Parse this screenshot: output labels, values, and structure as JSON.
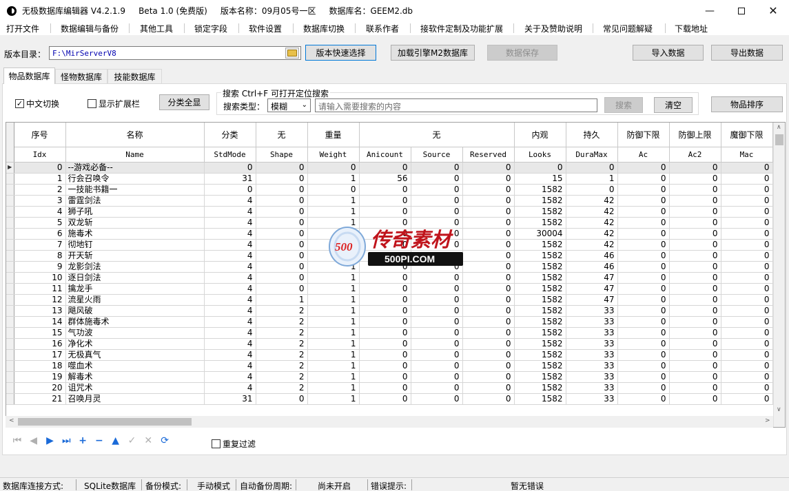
{
  "window": {
    "title": "无极数据库编辑器 V4.2.1.9     Beta 1.0 (免费版)     版本名称：09月05号一区     数据库名：GEEM2.db"
  },
  "menu": [
    "打开文件",
    "数据编辑与备份",
    "其他工具",
    "锁定字段",
    "软件设置",
    "数据库切换",
    "联系作者",
    "接软件定制及功能扩展",
    "关于及赞助说明",
    "常见问题解疑",
    "下载地址"
  ],
  "toolbar": {
    "version_dir_label": "版本目录：",
    "version_dir_value": "F:\\MirServerV8",
    "quick_select": "版本快速选择",
    "load_m2": "加载引擎M2数据库",
    "save": "数据保存",
    "import": "导入数据",
    "export": "导出数据"
  },
  "tabs": [
    "物品数据库",
    "怪物数据库",
    "技能数据库"
  ],
  "filters": {
    "chinese_switch": "中文切换",
    "chinese_checked": true,
    "show_ext": "显示扩展栏",
    "show_ext_checked": false,
    "category_all": "分类全显",
    "search_title": "搜索   Ctrl+F 可打开定位搜索",
    "search_type_label": "搜索类型：",
    "search_type_value": "模糊",
    "search_placeholder": "请输入需要搜索的内容",
    "search_btn": "搜索",
    "clear_btn": "清空",
    "sort_btn": "物品排序"
  },
  "grid": {
    "header_cn": [
      "序号",
      "名称",
      "分类",
      "无",
      "重量",
      "无",
      "内观",
      "持久",
      "防御下限",
      "防御上限",
      "魔御下限"
    ],
    "header_en": [
      "Idx",
      "Name",
      "StdMode",
      "Shape",
      "Weight",
      "Anicount",
      "Source",
      "Reserved",
      "Looks",
      "DuraMax",
      "Ac",
      "Ac2",
      "Mac"
    ],
    "rows": [
      [
        "0",
        "--游戏必备--",
        "0",
        "0",
        "0",
        "0",
        "0",
        "0",
        "0",
        "0",
        "0",
        "0",
        "0"
      ],
      [
        "1",
        "行会召唤令",
        "31",
        "0",
        "1",
        "56",
        "0",
        "0",
        "15",
        "1",
        "0",
        "0",
        "0"
      ],
      [
        "2",
        "一技能书籍一",
        "0",
        "0",
        "0",
        "0",
        "0",
        "0",
        "1582",
        "0",
        "0",
        "0",
        "0"
      ],
      [
        "3",
        "雷霆剑法",
        "4",
        "0",
        "1",
        "0",
        "0",
        "0",
        "1582",
        "42",
        "0",
        "0",
        "0"
      ],
      [
        "4",
        "狮子吼",
        "4",
        "0",
        "1",
        "0",
        "0",
        "0",
        "1582",
        "42",
        "0",
        "0",
        "0"
      ],
      [
        "5",
        "双龙斩",
        "4",
        "0",
        "1",
        "0",
        "0",
        "0",
        "1582",
        "42",
        "0",
        "0",
        "0"
      ],
      [
        "6",
        "施毒术",
        "4",
        "0",
        "1",
        "0",
        "0",
        "0",
        "30004",
        "42",
        "0",
        "0",
        "0"
      ],
      [
        "7",
        "彻地钉",
        "4",
        "0",
        "1",
        "0",
        "0",
        "0",
        "1582",
        "42",
        "0",
        "0",
        "0"
      ],
      [
        "8",
        "开天斩",
        "4",
        "0",
        "1",
        "0",
        "0",
        "0",
        "1582",
        "46",
        "0",
        "0",
        "0"
      ],
      [
        "9",
        "龙影剑法",
        "4",
        "0",
        "1",
        "0",
        "0",
        "0",
        "1582",
        "46",
        "0",
        "0",
        "0"
      ],
      [
        "10",
        "逐日剑法",
        "4",
        "0",
        "1",
        "0",
        "0",
        "0",
        "1582",
        "47",
        "0",
        "0",
        "0"
      ],
      [
        "11",
        "擒龙手",
        "4",
        "0",
        "1",
        "0",
        "0",
        "0",
        "1582",
        "47",
        "0",
        "0",
        "0"
      ],
      [
        "12",
        "流星火雨",
        "4",
        "1",
        "1",
        "0",
        "0",
        "0",
        "1582",
        "47",
        "0",
        "0",
        "0"
      ],
      [
        "13",
        "飓风破",
        "4",
        "2",
        "1",
        "0",
        "0",
        "0",
        "1582",
        "33",
        "0",
        "0",
        "0"
      ],
      [
        "14",
        "群体施毒术",
        "4",
        "2",
        "1",
        "0",
        "0",
        "0",
        "1582",
        "33",
        "0",
        "0",
        "0"
      ],
      [
        "15",
        "气功波",
        "4",
        "2",
        "1",
        "0",
        "0",
        "0",
        "1582",
        "33",
        "0",
        "0",
        "0"
      ],
      [
        "16",
        "净化术",
        "4",
        "2",
        "1",
        "0",
        "0",
        "0",
        "1582",
        "33",
        "0",
        "0",
        "0"
      ],
      [
        "17",
        "无极真气",
        "4",
        "2",
        "1",
        "0",
        "0",
        "0",
        "1582",
        "33",
        "0",
        "0",
        "0"
      ],
      [
        "18",
        "噬血术",
        "4",
        "2",
        "1",
        "0",
        "0",
        "0",
        "1582",
        "33",
        "0",
        "0",
        "0"
      ],
      [
        "19",
        "解毒术",
        "4",
        "2",
        "1",
        "0",
        "0",
        "0",
        "1582",
        "33",
        "0",
        "0",
        "0"
      ],
      [
        "20",
        "诅咒术",
        "4",
        "2",
        "1",
        "0",
        "0",
        "0",
        "1582",
        "33",
        "0",
        "0",
        "0"
      ],
      [
        "21",
        "召唤月灵",
        "31",
        "0",
        "1",
        "0",
        "0",
        "0",
        "1582",
        "33",
        "0",
        "0",
        "0"
      ]
    ]
  },
  "repeat_filter": "重复过滤",
  "watermark": {
    "brand_cn": "传奇素材",
    "brand_en": "500PI.COM",
    "logo_text": "500"
  },
  "status": {
    "conn_label": "数据库连接方式:",
    "conn_value": "SQLite数据库",
    "backup_label": "备份模式:",
    "backup_value": "手动模式",
    "auto_label": "自动备份周期:",
    "auto_value": "尚未开启",
    "error_label": "错误提示:",
    "error_value": "暂无错误"
  }
}
